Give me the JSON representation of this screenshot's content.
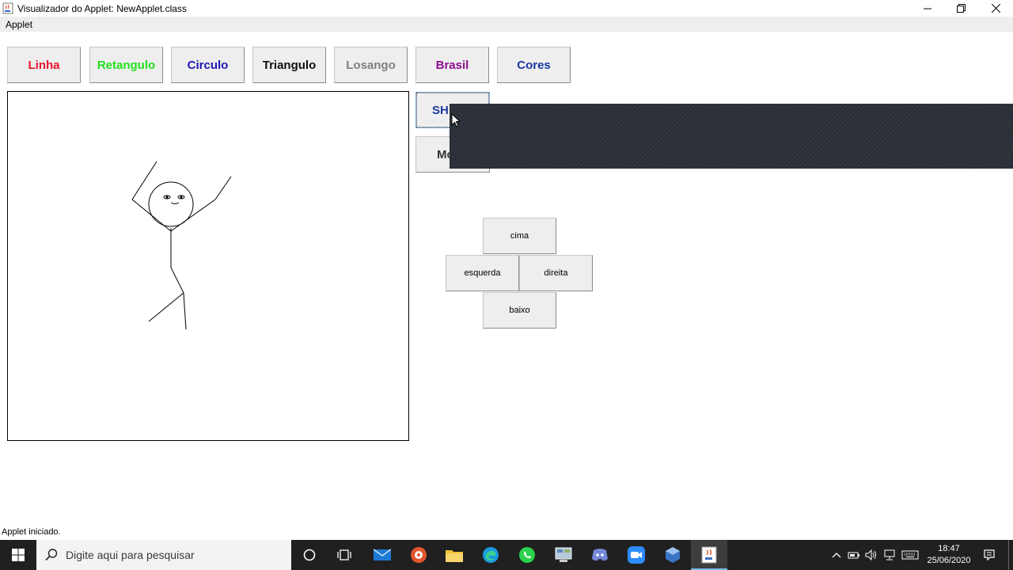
{
  "window": {
    "title": "Visualizador do Applet: NewApplet.class",
    "menu": [
      "Applet"
    ]
  },
  "toolbar": {
    "buttons": [
      {
        "label": "Linha",
        "color": "#e8142c"
      },
      {
        "label": "Retangulo",
        "color": "#22e01e"
      },
      {
        "label": "Circulo",
        "color": "#1f17b4"
      },
      {
        "label": "Triangulo",
        "color": "#111111"
      },
      {
        "label": "Losango",
        "color": "#808080"
      },
      {
        "label": "Brasil",
        "color": "#8b0f93"
      },
      {
        "label": "Cores",
        "color": "#1b3aa0"
      }
    ],
    "side_buttons": [
      {
        "label": "SH",
        "color": "#1b3aa0"
      },
      {
        "label": "Mo",
        "color": "#333333"
      }
    ]
  },
  "direction_pad": {
    "up": "cima",
    "left": "esquerda",
    "right": "direita",
    "down": "baixo"
  },
  "status": "Applet iniciado.",
  "taskbar": {
    "search_placeholder": "Digite aqui para pesquisar",
    "apps": [
      "cortana-icon",
      "task-view-icon",
      "mail-icon",
      "media-player-icon",
      "file-explorer-icon",
      "edge-icon",
      "whatsapp-icon",
      "control-panel-icon",
      "discord-icon",
      "zoom-icon",
      "virtualbox-icon",
      "java-icon"
    ],
    "time": "18:47",
    "date": "25/06/2020"
  },
  "colors": {
    "accent": "#76b9ed",
    "overlay": "#2a2f37"
  }
}
